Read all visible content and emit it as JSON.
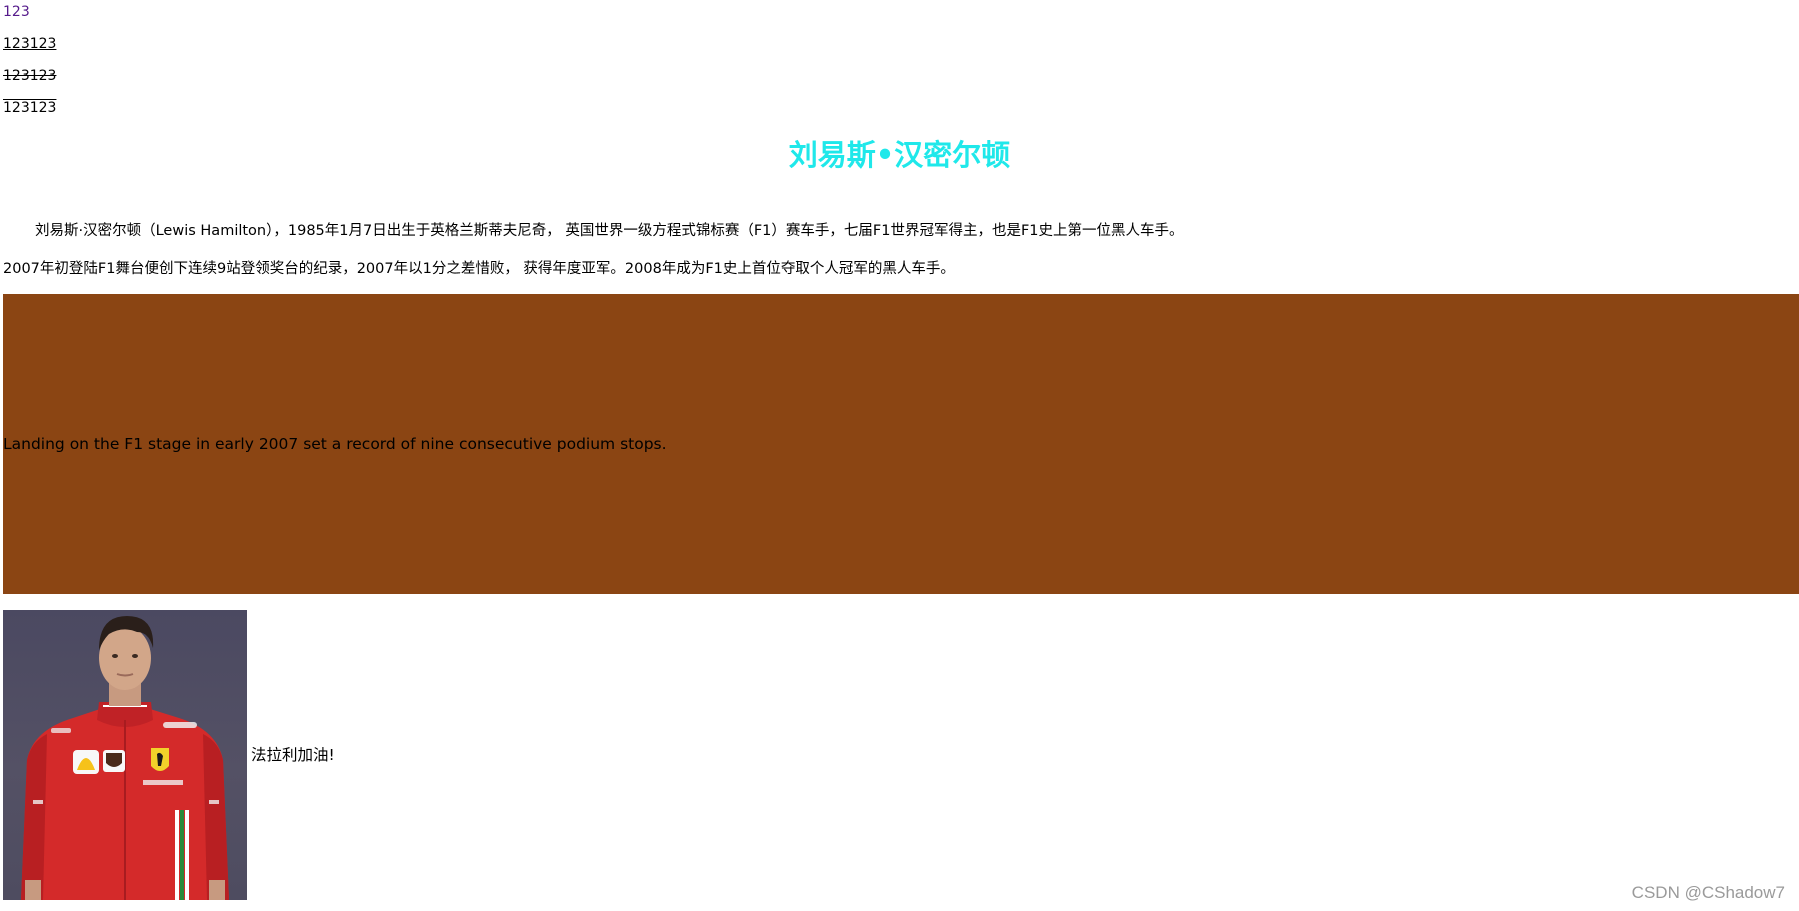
{
  "lines": {
    "link": "123",
    "underline": "123123",
    "strikethrough": "123123",
    "overline": "123123"
  },
  "article": {
    "title": "刘易斯•汉密尔顿",
    "paragraph1": "刘易斯·汉密尔顿（Lewis Hamilton），1985年1月7日出生于英格兰斯蒂夫尼奇， 英国世界一级方程式锦标赛（F1）赛车手，七届F1世界冠军得主，也是F1史上第一位黑人车手。",
    "paragraph2": "2007年初登陆F1舞台便创下连续9站登领奖台的纪录，2007年以1分之差惜败， 获得年度亚军。2008年成为F1史上首位夺取个人冠军的黑人车手。"
  },
  "banner": {
    "text": "Landing on the F1 stage in early 2007 set a record of nine consecutive podium stops.",
    "background_color": "#8b4513"
  },
  "photo_section": {
    "caption": "法拉利加油!"
  },
  "watermark": "CSDN @CShadow7",
  "colors": {
    "title": "#1fe8ea",
    "link": "#551a8b"
  }
}
